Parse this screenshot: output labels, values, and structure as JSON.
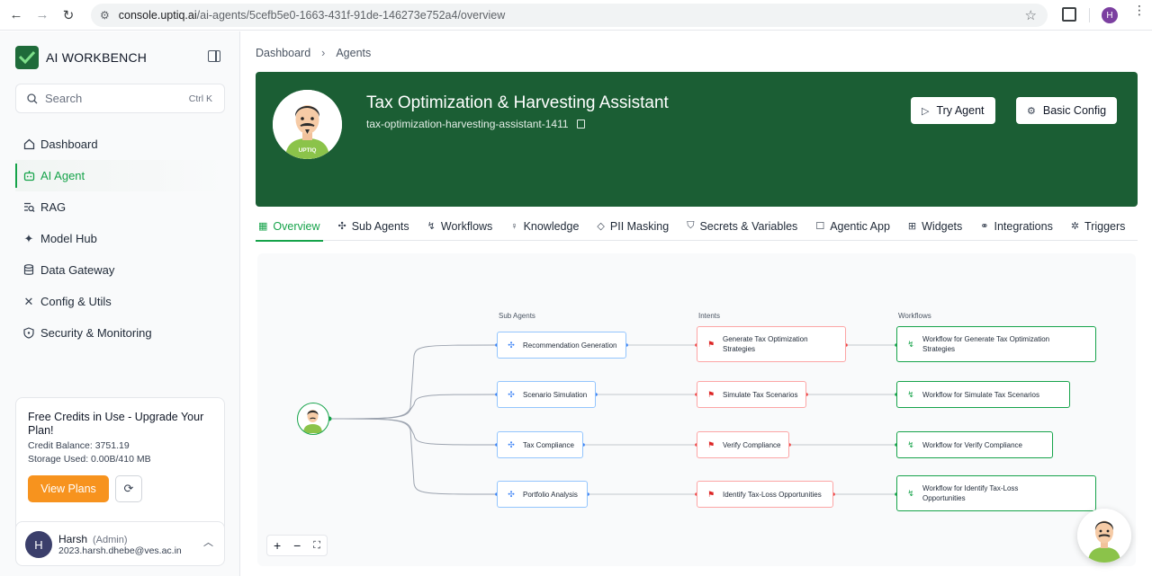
{
  "browser": {
    "url_host": "console.uptiq.ai",
    "url_path": "/ai-agents/5cefb5e0-1663-431f-91de-146273e752a4/overview",
    "profile_initial": "H"
  },
  "sidebar": {
    "brand": "AI WORKBENCH",
    "search_placeholder": "Search",
    "search_shortcut": "Ctrl K",
    "items": [
      {
        "label": "Dashboard",
        "icon": "home-icon"
      },
      {
        "label": "AI Agent",
        "icon": "bot-icon"
      },
      {
        "label": "RAG",
        "icon": "rag-icon"
      },
      {
        "label": "Model Hub",
        "icon": "sparkle-icon"
      },
      {
        "label": "Data Gateway",
        "icon": "database-icon"
      },
      {
        "label": "Config & Utils",
        "icon": "tools-icon"
      },
      {
        "label": "Security & Monitoring",
        "icon": "shield-icon"
      }
    ],
    "credits": {
      "title": "Free Credits in Use - Upgrade Your Plan!",
      "balance": "Credit Balance: 3751.19",
      "storage": "Storage Used: 0.00B/410 MB",
      "view_plans": "View Plans"
    },
    "user": {
      "initial": "H",
      "name": "Harsh",
      "role": "(Admin)",
      "email": "2023.harsh.dhebe@ves.ac.in"
    }
  },
  "breadcrumb": {
    "root": "Dashboard",
    "current": "Agents"
  },
  "agent": {
    "title": "Tax Optimization & Harvesting Assistant",
    "slug": "tax-optimization-harvesting-assistant-1411",
    "try_label": "Try Agent",
    "config_label": "Basic Config",
    "badge": "UPTIQ"
  },
  "tabs": [
    {
      "label": "Overview",
      "icon": "grid-icon"
    },
    {
      "label": "Sub Agents",
      "icon": "agents-icon"
    },
    {
      "label": "Workflows",
      "icon": "workflow-icon"
    },
    {
      "label": "Knowledge",
      "icon": "bulb-icon"
    },
    {
      "label": "PII Masking",
      "icon": "eraser-icon"
    },
    {
      "label": "Secrets & Variables",
      "icon": "shield-icon"
    },
    {
      "label": "Agentic App",
      "icon": "chat-icon"
    },
    {
      "label": "Widgets",
      "icon": "widgets-icon"
    },
    {
      "label": "Integrations",
      "icon": "link-icon"
    },
    {
      "label": "Triggers",
      "icon": "trigger-icon"
    }
  ],
  "flow": {
    "headers": {
      "sub_agents": "Sub Agents",
      "intents": "Intents",
      "workflows": "Workflows"
    },
    "rows": [
      {
        "sub": "Recommendation Generation",
        "intent": "Generate Tax Optimization Strategies",
        "workflow": "Workflow for Generate Tax Optimization Strategies"
      },
      {
        "sub": "Scenario Simulation",
        "intent": "Simulate Tax Scenarios",
        "workflow": "Workflow for Simulate Tax Scenarios"
      },
      {
        "sub": "Tax Compliance",
        "intent": "Verify Compliance",
        "workflow": "Workflow for Verify Compliance"
      },
      {
        "sub": "Portfolio Analysis",
        "intent": "Identify Tax-Loss Opportunities",
        "workflow": "Workflow for Identify Tax-Loss Opportunities"
      }
    ]
  },
  "colors": {
    "brand_green": "#1b5e34",
    "accent_green": "#16a34a",
    "view_plans_orange": "#f7931e",
    "sub_agent_border": "#93c5fd",
    "intent_border": "#fca5a5"
  }
}
